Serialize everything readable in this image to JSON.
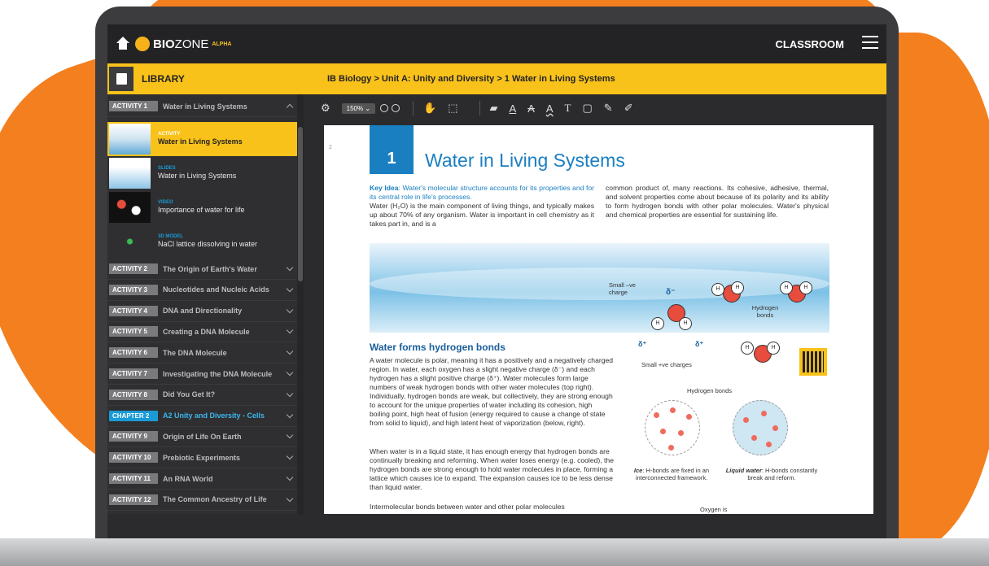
{
  "header": {
    "brand_bold": "BIO",
    "brand_rest": "ZONE",
    "brand_tag": "ALPHA",
    "classroom": "CLASSROOM"
  },
  "library": {
    "title": "LIBRARY",
    "breadcrumb": "IB Biology   >   Unit A: Unity and Diversity   >   1 Water in Living Systems"
  },
  "sidebar": {
    "activity1": {
      "badge": "ACTIVITY 1",
      "title": "Water in Living Systems"
    },
    "resources": [
      {
        "type": "ACTIVITY",
        "title": "Water in Living Systems",
        "active": true
      },
      {
        "type": "Slides",
        "title": "Water in Living Systems"
      },
      {
        "type": "Video",
        "title": "Importance of water for life"
      },
      {
        "type": "3D MODEL",
        "title": "NaCl lattice dissolving in water"
      }
    ],
    "items": [
      {
        "badge": "ACTIVITY 2",
        "title": "The Origin of Earth's Water"
      },
      {
        "badge": "ACTIVITY 3",
        "title": "Nucleotides and Nucleic Acids"
      },
      {
        "badge": "ACTIVITY 4",
        "title": "DNA and Directionality"
      },
      {
        "badge": "ACTIVITY 5",
        "title": "Creating a DNA Molecule"
      },
      {
        "badge": "ACTIVITY 6",
        "title": "The DNA Molecule"
      },
      {
        "badge": "ACTIVITY 7",
        "title": "Investigating the DNA Molecule"
      },
      {
        "badge": "ACTIVITY 8",
        "title": "Did You Get It?"
      },
      {
        "badge": "CHAPTER 2",
        "title": "A2 Unity and Diversity - Cells",
        "chapter": true
      },
      {
        "badge": "ACTIVITY 9",
        "title": "Origin of Life On Earth"
      },
      {
        "badge": "ACTIVITY 10",
        "title": "Prebiotic Experiments"
      },
      {
        "badge": "ACTIVITY 11",
        "title": "An RNA World"
      },
      {
        "badge": "ACTIVITY 12",
        "title": "The Common Ancestry of Life"
      }
    ]
  },
  "toolbar": {
    "zoom": "150% ⌄"
  },
  "page": {
    "number": "2",
    "chapter_num": "1",
    "title": "Water in Living Systems",
    "key_label": "Key Idea",
    "key_text": ": Water's molecular structure accounts for its properties and for its central role in life's processes.",
    "intro_left": "Water (H₂O) is the main component of living things, and typically makes up about 70% of any organism. Water is important in cell chemistry as it takes part in, and is a",
    "intro_right": "common product of, many reactions. Its cohesive, adhesive, thermal, and solvent properties come about because of its polarity and its ability to form hydrogen bonds with other polar molecules. Water's physical and chemical properties are essential for sustaining life.",
    "h2": "Water forms hydrogen bonds",
    "para1": "A water molecule is polar, meaning it has a positively and a negatively charged region. In water, each oxygen has a slight negative charge (δ⁻) and each hydrogen has a slight positive charge (δ⁺). Water molecules form large numbers of weak hydrogen bonds with other water molecules (top right). Individually, hydrogen bonds are weak, but collectively, they are strong enough to account for the unique properties of water including its cohesion, high boiling point, high heat of fusion (energy required to cause a change of state from solid to liquid), and high latent heat of vaporization (below, right).",
    "para2": "When water is in a liquid state, it has enough energy that hydrogen bonds are continually breaking and reforming. When water loses energy (e.g. cooled), the hydrogen bonds are strong enough to hold water molecules in place, forming a lattice which causes ice to expand. The expansion causes ice to be less dense than liquid water.",
    "para3": "Intermolecular bonds between water and other polar molecules",
    "small_neg": "Small –ve charge",
    "delta_neg": "δ⁻",
    "delta_pos": "δ⁺",
    "small_pos": "Small +ve charges",
    "hbonds_label": "Hydrogen bonds",
    "hbonds_short": "Hydrogen bonds",
    "ice_caption_b": "Ice",
    "ice_caption": ": H-bonds are fixed in an interconnected framework.",
    "liq_caption_b": "Liquid water",
    "liq_caption": ": H-bonds constantly break and reform.",
    "oxygen_is": "Oxygen is",
    "H": "H",
    "O": "O"
  }
}
